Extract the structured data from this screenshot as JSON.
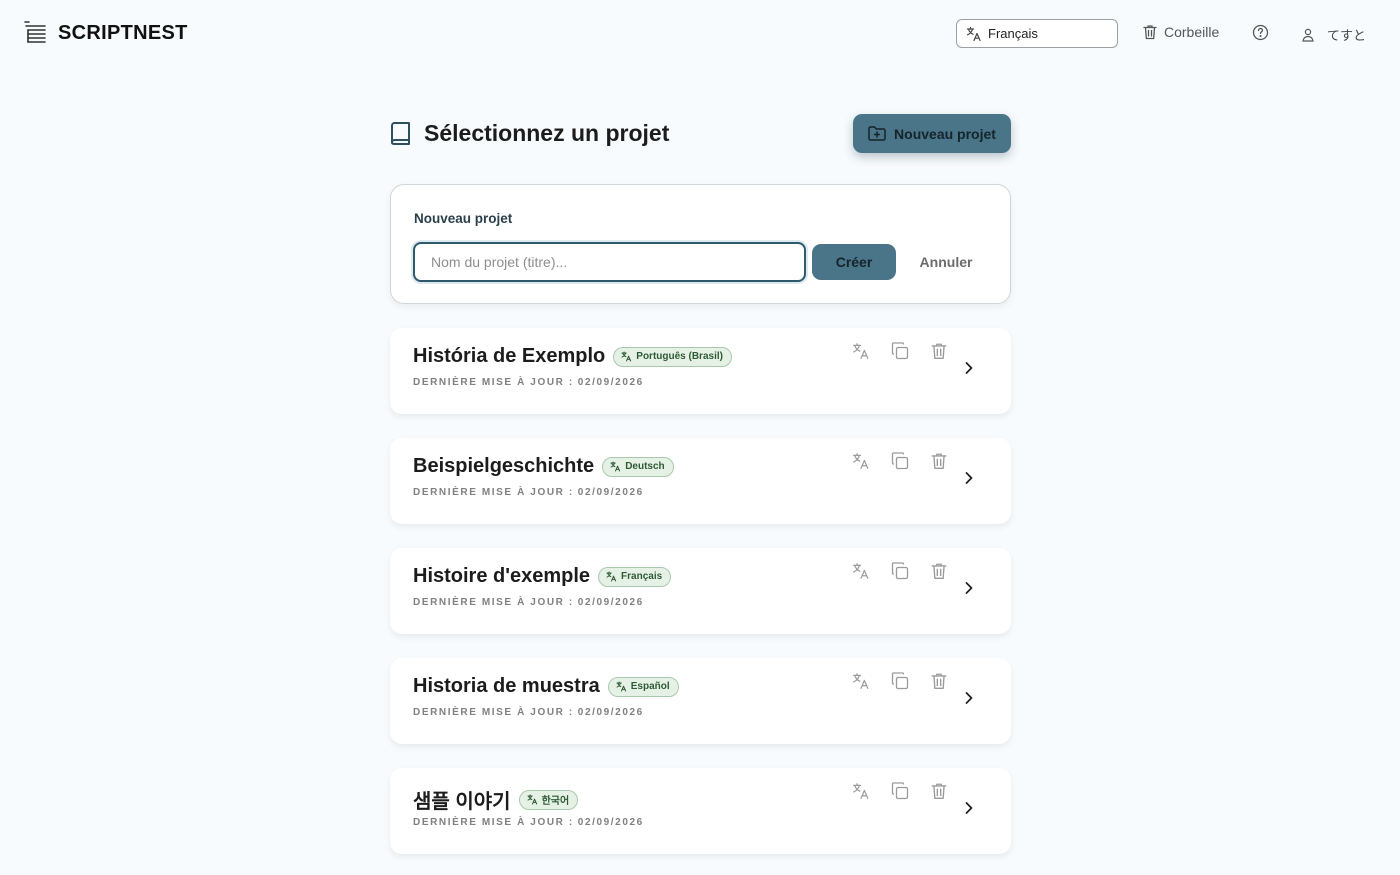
{
  "header": {
    "brand": "SCRIPTNEST",
    "language_selector": {
      "value": "Français",
      "icon": "translate-icon"
    },
    "trash_label": "Corbeille",
    "help_icon": "help-circle-icon",
    "user_name": "てすと"
  },
  "main": {
    "page_title": "Sélectionnez un projet",
    "new_project_button": "Nouveau projet"
  },
  "new_project_form": {
    "label": "Nouveau projet",
    "input_placeholder": "Nom du projet (titre)...",
    "input_value": "",
    "create_button": "Créer",
    "cancel_button": "Annuler"
  },
  "projects": [
    {
      "title": "História de Exemplo",
      "language": "Português (Brasil)",
      "updated_label": "DERNIÈRE MISE À JOUR :",
      "date": "02/09/2026"
    },
    {
      "title": "Beispielgeschichte",
      "language": "Deutsch",
      "updated_label": "DERNIÈRE MISE À JOUR :",
      "date": "02/09/2026"
    },
    {
      "title": "Histoire d'exemple",
      "language": "Français",
      "updated_label": "DERNIÈRE MISE À JOUR :",
      "date": "02/09/2026"
    },
    {
      "title": "Historia de muestra",
      "language": "Español",
      "updated_label": "DERNIÈRE MISE À JOUR :",
      "date": "02/09/2026"
    },
    {
      "title": "샘플 이야기",
      "language": "한국어",
      "updated_label": "DERNIÈRE MISE À JOUR :",
      "date": "02/09/2026"
    }
  ],
  "colors": {
    "accent": "#4a7589",
    "background": "#f8fbfd",
    "badge_bg": "#e6f1e6",
    "badge_text": "#2e5a35"
  }
}
